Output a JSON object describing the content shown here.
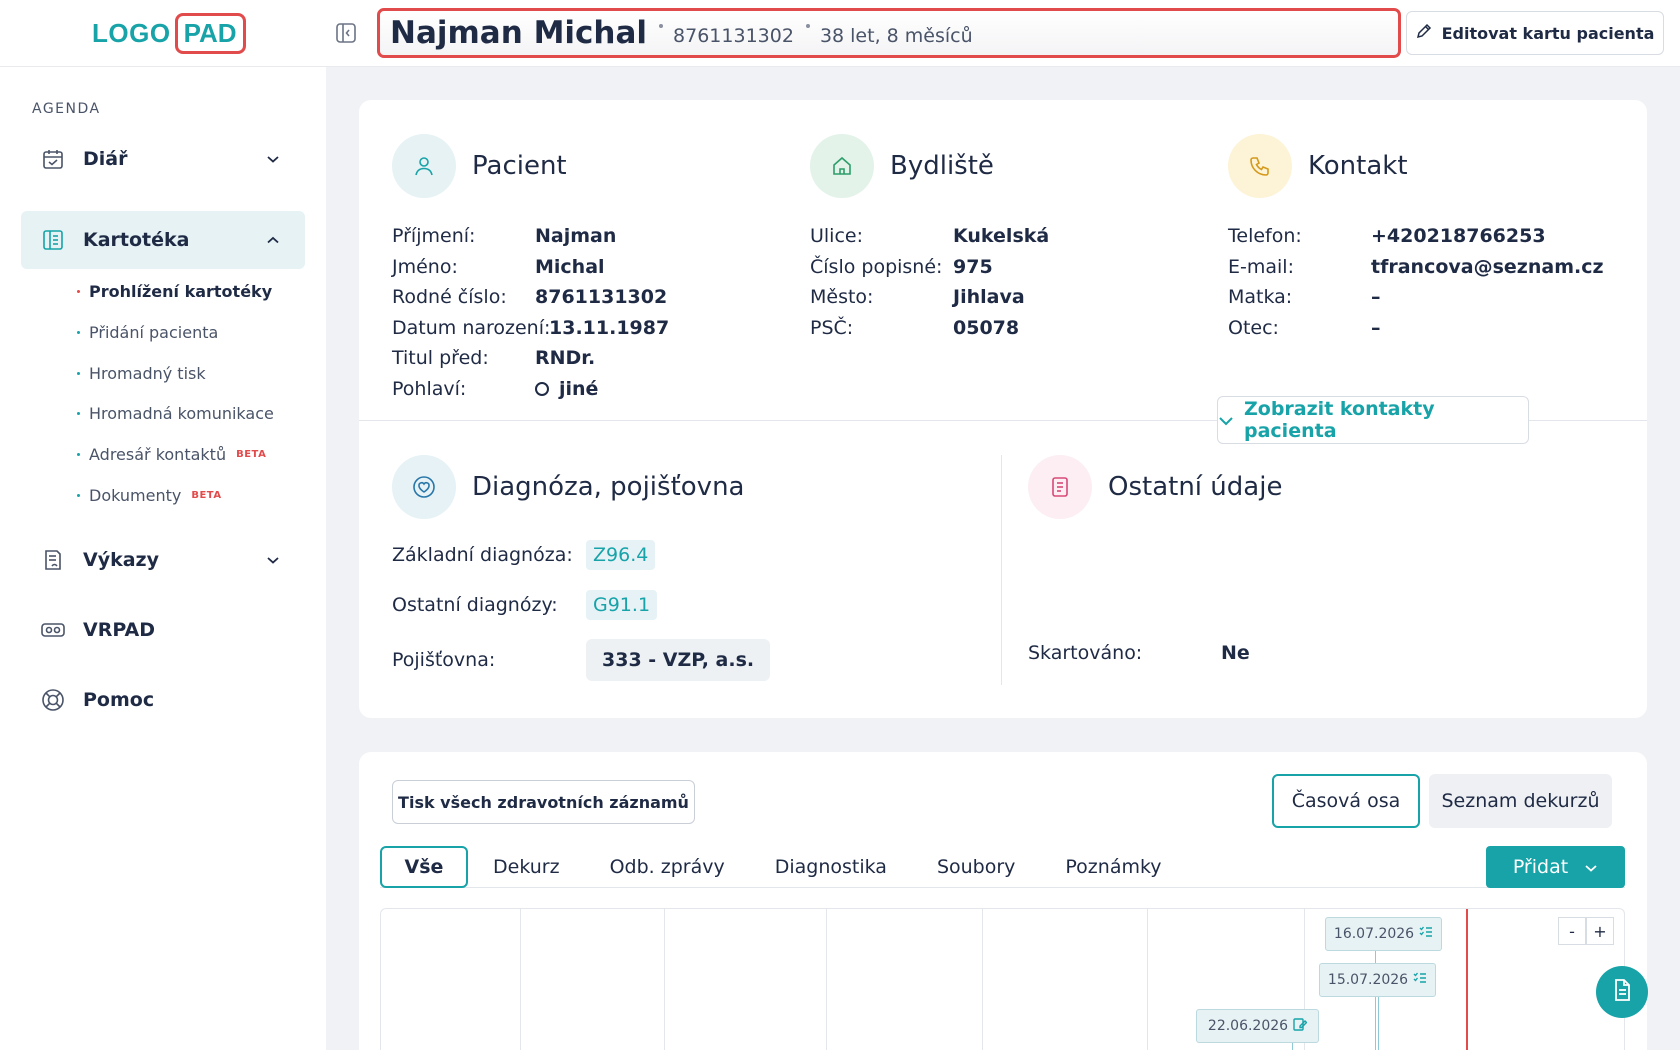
{
  "logo": {
    "part1": "LOGO",
    "part2": "PAD"
  },
  "sidebar": {
    "section_label": "AGENDA",
    "items": [
      {
        "label": "Diář",
        "icon": "calendar-icon"
      },
      {
        "label": "Kartotéka",
        "icon": "kartoteka-icon"
      },
      {
        "label": "Výkazy",
        "icon": "report-icon"
      },
      {
        "label": "VRPAD",
        "icon": "vr-headset-icon"
      },
      {
        "label": "Pomoc",
        "icon": "lifebuoy-icon"
      }
    ],
    "subitems": [
      {
        "label": "Prohlížení kartotéky"
      },
      {
        "label": "Přidání pacienta"
      },
      {
        "label": "Hromadný tisk"
      },
      {
        "label": "Hromadná komunikace"
      },
      {
        "label": "Adresář kontaktů",
        "badge": "BETA"
      },
      {
        "label": "Dokumenty",
        "badge": "BETA"
      }
    ]
  },
  "header": {
    "patient_name": "Najman Michal",
    "birth_number": "8761131302",
    "age": "38 let, 8 měsíců",
    "edit_label": "Editovat kartu pacienta"
  },
  "patient": {
    "title": "Pacient",
    "fields": [
      {
        "k": "Příjmení:",
        "v": "Najman"
      },
      {
        "k": "Jméno:",
        "v": "Michal"
      },
      {
        "k": "Rodné číslo:",
        "v": "8761131302"
      },
      {
        "k": "Datum narození:",
        "v": "13.11.1987"
      },
      {
        "k": "Titul před:",
        "v": "RNDr."
      },
      {
        "k": "Pohlaví:",
        "v": "jiné"
      }
    ]
  },
  "address": {
    "title": "Bydliště",
    "fields": [
      {
        "k": "Ulice:",
        "v": "Kukelská"
      },
      {
        "k": "Číslo popisné:",
        "v": "975"
      },
      {
        "k": "Město:",
        "v": "Jihlava"
      },
      {
        "k": "PSČ:",
        "v": "05078"
      }
    ]
  },
  "contact": {
    "title": "Kontakt",
    "fields": [
      {
        "k": "Telefon:",
        "v": "+420218766253"
      },
      {
        "k": "E-mail:",
        "v": "tfrancova@seznam.cz"
      },
      {
        "k": "Matka:",
        "v": "–"
      },
      {
        "k": "Otec:",
        "v": "–"
      }
    ],
    "show_contacts_label": "Zobrazit kontakty pacienta"
  },
  "diagnosis": {
    "title": "Diagnóza, pojišťovna",
    "main_label": "Základní diagnóza:",
    "main_value": "Z96.4",
    "other_label": "Ostatní diagnózy:",
    "other_value": "G91.1",
    "insurance_label": "Pojišťovna:",
    "insurance_value": "333 - VZP, a.s."
  },
  "other_info": {
    "title": "Ostatní údaje",
    "k": "Skartováno:",
    "v": "Ne"
  },
  "records": {
    "print_all_label": "Tisk všech zdravotních záznamů",
    "view_timeline": "Časová osa",
    "view_list": "Seznam dekurzů",
    "tabs": [
      "Vše",
      "Dekurz",
      "Odb. zprávy",
      "Diagnostika",
      "Soubory",
      "Poznámky"
    ],
    "add_label": "Přidat",
    "events": [
      "16.07.2026",
      "15.07.2026",
      "22.06.2026"
    ],
    "zoom_out": "-",
    "zoom_in": "+"
  },
  "colors": {
    "accent": "#17a3a8",
    "highlight": "#e24b4b",
    "text": "#1f2a44"
  }
}
